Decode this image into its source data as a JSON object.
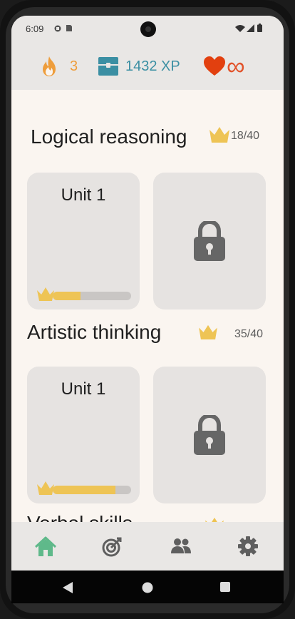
{
  "status_bar": {
    "time": "6:09"
  },
  "top_bar": {
    "streak": "3",
    "xp": "1432 XP",
    "hearts": "∞"
  },
  "sections": [
    {
      "title": "Logical reasoning",
      "progress": "18/40",
      "units": [
        {
          "title": "Unit 1",
          "progress_fraction": 0.35
        }
      ],
      "locked_units": 1
    },
    {
      "title": "Artistic thinking",
      "progress": "35/40",
      "units": [
        {
          "title": "Unit 1",
          "progress_fraction": 0.8
        }
      ],
      "locked_units": 1
    },
    {
      "title": "Verbal skills"
    }
  ],
  "nav": {
    "items": [
      "home-icon",
      "target-icon",
      "people-icon",
      "gear-icon"
    ],
    "active": "home-icon"
  },
  "colors": {
    "streak": "#ee9d3b",
    "xp": "#3b8fa3",
    "hearts": "#e2532a",
    "crown": "#eec455",
    "nav_active": "#5fb98a",
    "nav_inactive": "#5f5f5f",
    "lock": "#666666"
  }
}
